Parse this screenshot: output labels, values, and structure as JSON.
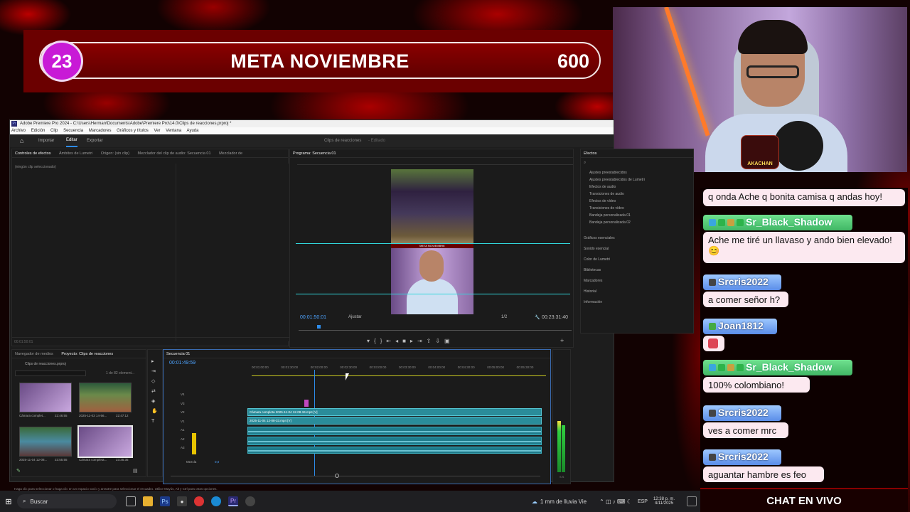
{
  "meta": {
    "current": "23",
    "title": "META NOVIEMBRE",
    "goal": "600"
  },
  "cam_badge": {
    "top": "NACIÓN",
    "bottom": "AKACHAN"
  },
  "premiere": {
    "window_title": "Adobe Premiere Pro 2024 - C:\\Users\\Herman\\Documents\\Adobe\\Premiere Pro\\14.0\\Clips de reacciones.prproj *",
    "menu": [
      "Archivo",
      "Edición",
      "Clip",
      "Secuencia",
      "Marcadores",
      "Gráficos y títulos",
      "Ver",
      "Ventana",
      "Ayuda"
    ],
    "workspace_tabs": [
      "Importar",
      "Editar",
      "Exportar"
    ],
    "project_title": "Clips de reacciones",
    "project_status": "- Editado",
    "source_tabs": [
      "Controles de efectos",
      "Ámbitos de Lumetri",
      "Origen: (sin clip)",
      "Mezclador del clip de audio: Secuencia 01",
      "Mezclador de"
    ],
    "no_clip": "(ningún clip seleccionado)",
    "source_time": "00:01:50:01",
    "program_tab": "Programa: Secuencia 01",
    "program_time": "00:01:50:01",
    "fit_label": "Ajustar",
    "fraction": "1/2",
    "duration": "00:23:31:40",
    "overlay_mini": "META NOVIEMBRE",
    "effects_tab": "Efectos",
    "effects_items": [
      "Ajustes preestablecidos",
      "Ajustes preestablecidos de Lumetri",
      "Efectos de audio",
      "Transiciones de audio",
      "Efectos de vídeo",
      "Transiciones de vídeo",
      "Bandeja personalizada 01",
      "Bandeja personalizada 02"
    ],
    "side_panels": [
      "Gráficos esenciales",
      "Sonido esencial",
      "Color de Lumetri",
      "Bibliotecas",
      "Marcadores",
      "Historial",
      "Información"
    ],
    "project_tabs": [
      "Navegador de medios",
      "Proyecto: Clips de reacciones"
    ],
    "project_file": "Clips de reacciones.prproj",
    "project_count": "1 de 82 element...",
    "thumbs": [
      {
        "name": "Cámara complet...",
        "dur": "22:46:55"
      },
      {
        "name": "2025-11-03 14-56...",
        "dur": "22:47:12"
      },
      {
        "name": "2025-11-04 12-08...",
        "dur": "23:55:55"
      },
      {
        "name": "Cámara completa...",
        "dur": "23:35:35"
      }
    ],
    "sequence_tab": "Secuencia 01",
    "timeline_time": "00:01:49:59",
    "ruler": [
      "00:01:00:00",
      "00:01:30:00",
      "00:02:00:00",
      "00:02:30:00",
      "00:03:00:00",
      "00:03:30:00",
      "00:04:00:00",
      "00:04:30:00",
      "00:05:00:00",
      "00:05:30:00"
    ],
    "video_tracks": [
      "V4",
      "V3",
      "V2",
      "V1"
    ],
    "audio_tracks": [
      "A1",
      "A2",
      "A3"
    ],
    "mix_label": "Mezcla",
    "mix_value": "0,0",
    "clip_v2": "Cámara completa 2025-11-04 12-08-34.mp4 [V]",
    "clip_v1": "2025-11-04 12-08-33.mp4 [V]",
    "meter_scale": [
      "0",
      "-6",
      "-12",
      "-18",
      "-24",
      "-30",
      "-36",
      "-42",
      "-48",
      "-54"
    ],
    "meter_footer": "S S",
    "status_hint": "Haga clic para seleccionar o haga clic en un espacio vacío y arrastre para seleccionar el recuadro. Utilice Mayús, Alt y Ctrl para otras opciones."
  },
  "chat": {
    "messages": [
      {
        "user": "",
        "text": "q onda Ache q bonita camisa q andas hoy!"
      },
      {
        "user": "Sr_Black_Shadow",
        "text": "Ache me tiré un llavaso y ando bien elevado! 😊",
        "style": "green"
      },
      {
        "user": "Srcris2022",
        "text": "a comer señor h?",
        "style": "blue"
      },
      {
        "user": "Joan1812",
        "text": "",
        "style": "blue"
      },
      {
        "user": "Sr_Black_Shadow",
        "text": "100% colombiano!",
        "style": "green"
      },
      {
        "user": "Srcris2022",
        "text": "ves a comer mrc",
        "style": "blue"
      },
      {
        "user": "Srcris2022",
        "text": "aguantar hambre es feo",
        "style": "blue"
      }
    ],
    "footer": "CHAT EN VIVO"
  },
  "taskbar": {
    "search": "Buscar",
    "weather": "1 mm de lluvia Vie",
    "lang": "ESP",
    "time": "12:38 p. m.",
    "date": "4/11/2025"
  }
}
